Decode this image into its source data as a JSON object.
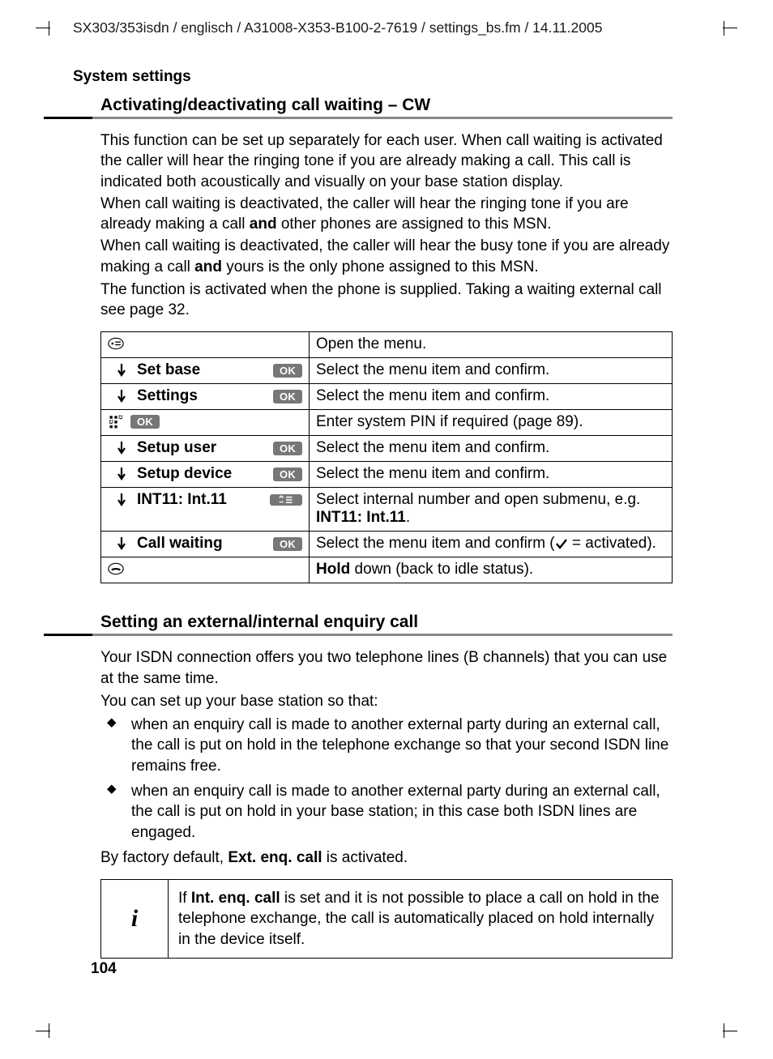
{
  "header_path": "SX303/353isdn / englisch / A31008-X353-B100-2-7619 / settings_bs.fm / 14.11.2005",
  "section_header": "System settings",
  "page_number": "104",
  "cw": {
    "title": "Activating/deactivating call waiting – CW",
    "p1": "This function can be set up separately for each user. When call waiting is activated the caller will hear the ringing tone if you are already making a call. This call is indicated both acoustically and visually on your base station display.",
    "p2a": "When call waiting is deactivated, the caller will hear the ringing tone if you are already making a call ",
    "p2b": "and",
    "p2c": " other phones are assigned to this MSN.",
    "p3a": "When call waiting is deactivated, the caller will hear the busy tone if you are already making a call ",
    "p3b": "and",
    "p3c": " yours is the only phone assigned to this MSN.",
    "p4": "The function is activated when the phone is supplied. Taking a waiting external call see page 32.",
    "table": {
      "ok": "OK",
      "r1": {
        "desc": "Open the menu."
      },
      "r2": {
        "label": "Set base",
        "desc": "Select the menu item and confirm."
      },
      "r3": {
        "label": "Settings",
        "desc": "Select the menu item and confirm."
      },
      "r4": {
        "desc": "Enter system PIN if required (page 89)."
      },
      "r5": {
        "label": "Setup user",
        "desc": "Select the menu item and confirm."
      },
      "r6": {
        "label": "Setup device",
        "desc": "Select the menu item and confirm."
      },
      "r7": {
        "label": "INT11: Int.11",
        "desc_a": "Select internal number and open submenu, e.g. ",
        "desc_b": "INT11: Int.11",
        "desc_c": "."
      },
      "r8": {
        "label": "Call waiting",
        "desc_a": "Select the menu item and confirm (",
        "desc_b": " = activated)."
      },
      "r9": {
        "desc_a": "Hold",
        "desc_b": " down (back to idle status)."
      }
    }
  },
  "enquiry": {
    "title": "Setting an external/internal enquiry call",
    "p1": "Your ISDN connection offers you two telephone lines (B channels) that you can use at the same time.",
    "p2": "You can set up your base station so that:",
    "li1": "when an enquiry call is made to another external party during an external call, the call is put on hold in the telephone exchange so that your second ISDN line remains free.",
    "li2": "when an enquiry call is made to another external party during an external call, the call is put on hold in your base station; in this case both ISDN lines are engaged.",
    "p3a": "By factory default, ",
    "p3b": "Ext. enq. call",
    "p3c": " is activated.",
    "note_a": "If ",
    "note_b": "Int. enq. call",
    "note_c": " is set and it is not possible to place a call on hold in the telephone exchange, the call is automatically placed on hold internally in the device itself."
  }
}
